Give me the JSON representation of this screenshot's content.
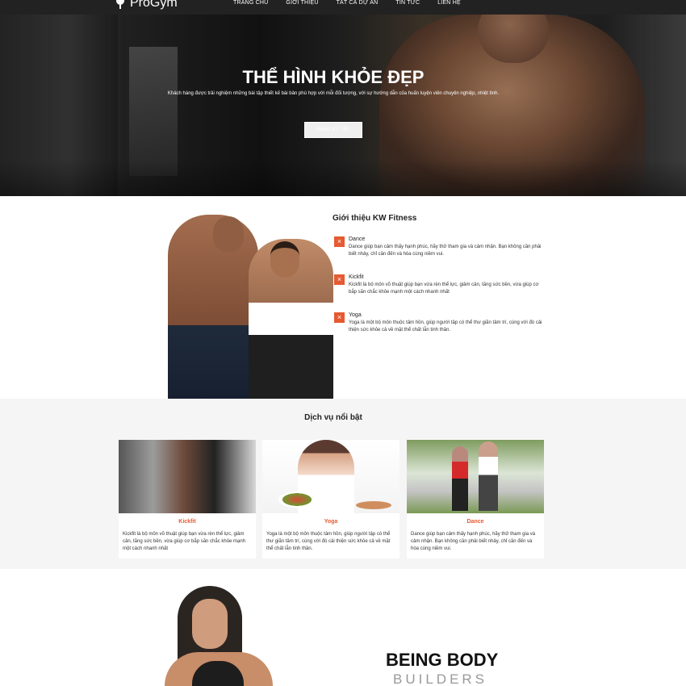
{
  "brand": {
    "name": "ProGym"
  },
  "nav": [
    "TRANG CHỦ",
    "GIỚI THIỆU",
    "TẤT CẢ DỰ ÁN",
    "TIN TỨC",
    "LIÊN HỆ"
  ],
  "hero": {
    "title": "THỂ HÌNH KHỎE ĐẸP",
    "text": "Khách hàng được trải nghiệm những bài tập thiết kế bài bản phù hợp với mỗi đối tượng, với sự hướng dẫn của huấn luyện viên chuyên nghiệp, nhiệt tình.",
    "button": "ĐĂNG KÝ TẬP"
  },
  "intro": {
    "title": "Giới thiệu KW Fitness",
    "features": [
      {
        "name": "Dance",
        "desc": "Dance giúp bạn cảm thấy hạnh phúc, hãy thử tham gia và cảm nhận. Bạn không cần phải biết nhảy, chỉ cần đến và hòa cùng niềm vui."
      },
      {
        "name": "Kickfit",
        "desc": "Kickfit là bộ môn võ thuật giúp bạn vừa rèn thể lực, giảm cân, tăng sức bền, vừa giúp cơ bắp săn chắc khỏe mạnh một cách nhanh nhất"
      },
      {
        "name": "Yoga",
        "desc": "Yoga là một bộ môn thuộc tâm hồn, giúp người tập có thể thư giãn tâm trí, cùng với đó cải thiện sức khỏe cả về mặt thể chất lẫn tinh thần."
      }
    ]
  },
  "services": {
    "title": "Dịch vụ nổi bật",
    "cards": [
      {
        "title": "Kickfit",
        "desc": "Kickfit là bộ môn võ thuật giúp bạn vừa rèn thể lực, giảm cân, tăng sức bền, vừa giúp cơ bắp săn chắc khỏe mạnh một cách nhanh nhất"
      },
      {
        "title": "Yoga",
        "desc": "Yoga là một bộ môn thuộc tâm hồn, giúp người tập có thể thư giãn tâm trí, cùng với đó cải thiện sức khỏe cả về mặt thể chất lẫn tinh thần."
      },
      {
        "title": "Dance",
        "desc": "Dance giúp bạn cảm thấy hạnh phúc, hãy thử tham gia và cảm nhận. Bạn không cần phải biết nhảy, chỉ cần đến và hòa cùng niềm vui."
      }
    ]
  },
  "bottom": {
    "title": "BEING BODY",
    "subtitle": "BUILDERS"
  },
  "colors": {
    "accent": "#e65a32",
    "topbar": "#222222",
    "services_bg": "#f5f5f5"
  }
}
